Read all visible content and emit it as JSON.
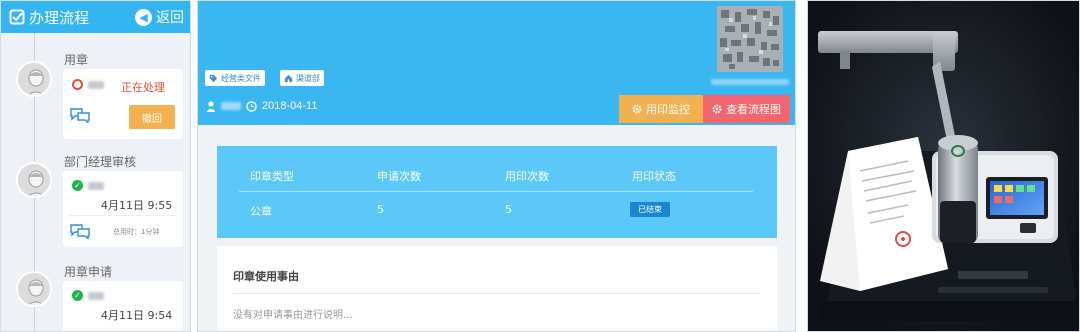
{
  "flow_panel": {
    "title": "办理流程",
    "back_label": "返回",
    "stages": [
      {
        "label": "用章",
        "status": "正在处理",
        "action_button": "撤回"
      },
      {
        "label": "部门经理审核",
        "date": "4月11日 9:55",
        "used_time": "总用时：1分钟"
      },
      {
        "label": "用章申请",
        "date": "4月11日 9:54"
      }
    ]
  },
  "detail_panel": {
    "tags": [
      "经营类文件",
      "渠道部"
    ],
    "date": "2018-04-11",
    "buttons": {
      "monitor": "用印监控",
      "flowchart": "查看流程图"
    },
    "table": {
      "headers": [
        "印章类型",
        "申请次数",
        "用印次数",
        "用印状态"
      ],
      "rows": [
        {
          "seal_type": "公章",
          "apply_count": "5",
          "use_count": "5",
          "status": "已结束"
        }
      ]
    },
    "reason": {
      "title": "印章使用事由",
      "placeholder": "没有对申请事由进行说明..."
    }
  },
  "colors": {
    "header_blue": "#33b5ef",
    "table_blue": "#5cc8f7",
    "orange": "#f2b04e",
    "pink": "#f2666f",
    "status_red": "#e54b3c",
    "check_green": "#22b14c",
    "badge_blue": "#1a86d1"
  },
  "icons": [
    "checkbox-icon",
    "back-arrow-icon",
    "avatar-icon",
    "clock-icon",
    "check-icon",
    "chat-icon",
    "tag-icon",
    "home-icon",
    "user-icon",
    "clock-outline-icon",
    "gear-icon",
    "qr-code-icon"
  ]
}
